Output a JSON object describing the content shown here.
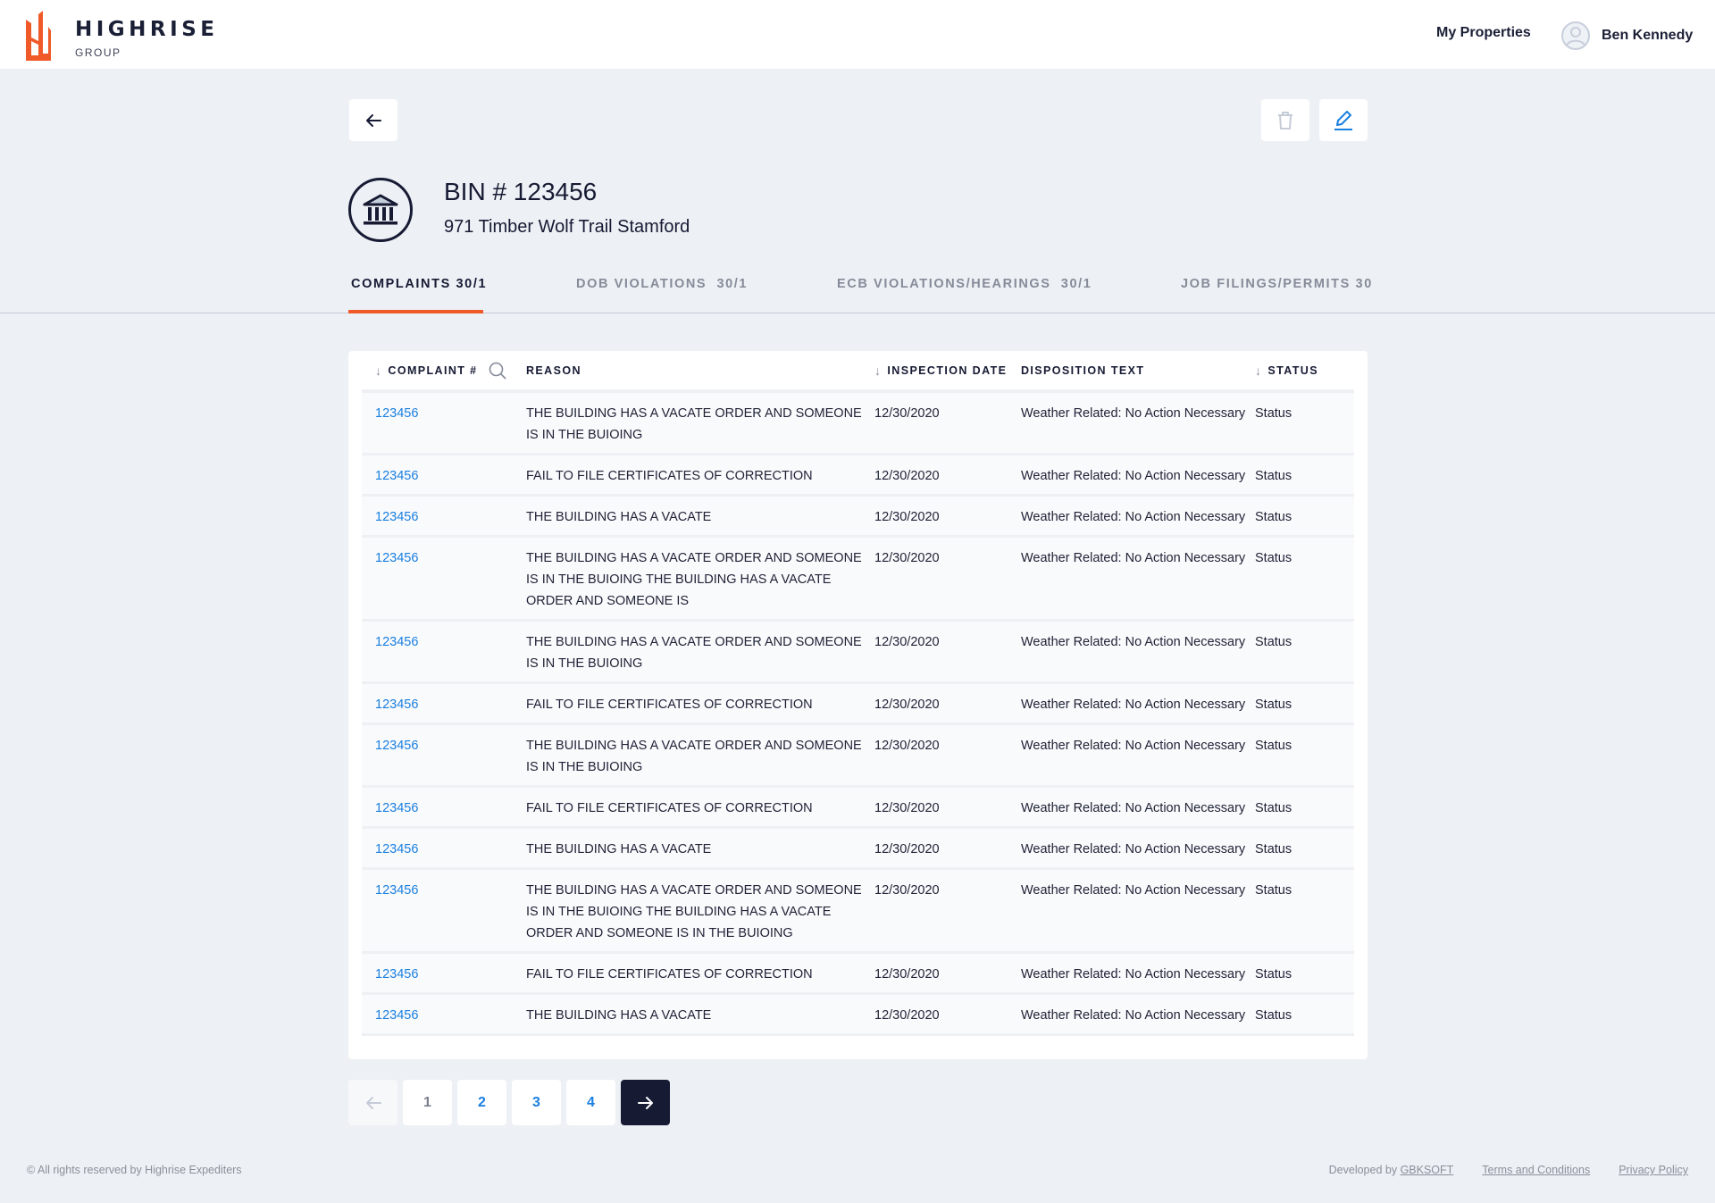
{
  "brand": {
    "title": "HIGHRISE",
    "subtitle": "GROUP",
    "accent_color": "#f05a28"
  },
  "nav": {
    "my_properties": "My Properties",
    "user_name": "Ben Kennedy"
  },
  "property": {
    "bin": "BIN # 123456",
    "address": "971 Timber Wolf Trail Stamford"
  },
  "tabs": [
    {
      "label": "COMPLAINTS 30/1",
      "active": true
    },
    {
      "label": "DOB VIOLATIONS  30/1",
      "active": false
    },
    {
      "label": "ECB VIOLATIONS/HEARINGS  30/1",
      "active": false
    },
    {
      "label": "JOB FILINGS/PERMITS 30",
      "active": false
    }
  ],
  "table": {
    "headers": {
      "complaint": "COMPLAINT #",
      "reason": "REASON",
      "inspection_date": "INSPECTION DATE",
      "disposition": "DISPOSITION TEXT",
      "status": "STATUS"
    },
    "rows": [
      {
        "complaint": "123456",
        "reason": "THE BUILDING HAS A VACATE ORDER AND SOMEONE IS IN THE BUIOING",
        "date": "12/30/2020",
        "disposition": "Weather Related: No Action Necessary",
        "status": "Status"
      },
      {
        "complaint": "123456",
        "reason": "FAIL TO FILE CERTIFICATES OF CORRECTION",
        "date": "12/30/2020",
        "disposition": "Weather Related: No Action Necessary",
        "status": "Status"
      },
      {
        "complaint": "123456",
        "reason": "THE BUILDING HAS A VACATE",
        "date": "12/30/2020",
        "disposition": "Weather Related: No Action Necessary",
        "status": "Status"
      },
      {
        "complaint": "123456",
        "reason": "THE BUILDING HAS A VACATE ORDER AND SOMEONE IS IN THE BUIOING THE BUILDING HAS A VACATE ORDER AND SOMEONE IS",
        "date": "12/30/2020",
        "disposition": "Weather Related: No Action Necessary",
        "status": "Status"
      },
      {
        "complaint": "123456",
        "reason": "THE BUILDING HAS A VACATE ORDER AND SOMEONE IS IN THE BUIOING",
        "date": "12/30/2020",
        "disposition": "Weather Related: No Action Necessary",
        "status": "Status"
      },
      {
        "complaint": "123456",
        "reason": "FAIL TO FILE CERTIFICATES OF CORRECTION",
        "date": "12/30/2020",
        "disposition": "Weather Related: No Action Necessary",
        "status": "Status"
      },
      {
        "complaint": "123456",
        "reason": "THE BUILDING HAS A VACATE ORDER AND SOMEONE IS IN THE BUIOING",
        "date": "12/30/2020",
        "disposition": "Weather Related: No Action Necessary",
        "status": "Status"
      },
      {
        "complaint": "123456",
        "reason": "FAIL TO FILE CERTIFICATES OF CORRECTION",
        "date": "12/30/2020",
        "disposition": "Weather Related: No Action Necessary",
        "status": "Status"
      },
      {
        "complaint": "123456",
        "reason": "THE BUILDING HAS A VACATE",
        "date": "12/30/2020",
        "disposition": "Weather Related: No Action Necessary",
        "status": "Status"
      },
      {
        "complaint": "123456",
        "reason": "THE BUILDING HAS A VACATE ORDER AND SOMEONE IS IN THE BUIOING THE BUILDING HAS A VACATE ORDER AND SOMEONE IS IN THE BUIOING",
        "date": "12/30/2020",
        "disposition": "Weather Related: No Action Necessary",
        "status": "Status"
      },
      {
        "complaint": "123456",
        "reason": "FAIL TO FILE CERTIFICATES OF CORRECTION",
        "date": "12/30/2020",
        "disposition": "Weather Related: No Action Necessary",
        "status": "Status"
      },
      {
        "complaint": "123456",
        "reason": "THE BUILDING HAS A VACATE",
        "date": "12/30/2020",
        "disposition": "Weather Related: No Action Necessary",
        "status": "Status"
      }
    ]
  },
  "pagination": {
    "pages": [
      "1",
      "2",
      "3",
      "4"
    ],
    "current": "1"
  },
  "footer": {
    "copyright": "© All rights reserved by Highrise Expediters",
    "developed_by": "Developed by ",
    "developer": "GBKSOFT",
    "terms": "Terms and Conditions",
    "privacy": "Privacy Policy"
  },
  "icons": {
    "back": "arrow-left-icon",
    "delete": "trash-icon",
    "edit": "pencil-icon",
    "property": "bank-building-icon",
    "search": "search-icon",
    "sort": "arrow-down-icon",
    "prev": "arrow-left-icon",
    "next": "arrow-right-icon",
    "avatar": "user-icon"
  }
}
